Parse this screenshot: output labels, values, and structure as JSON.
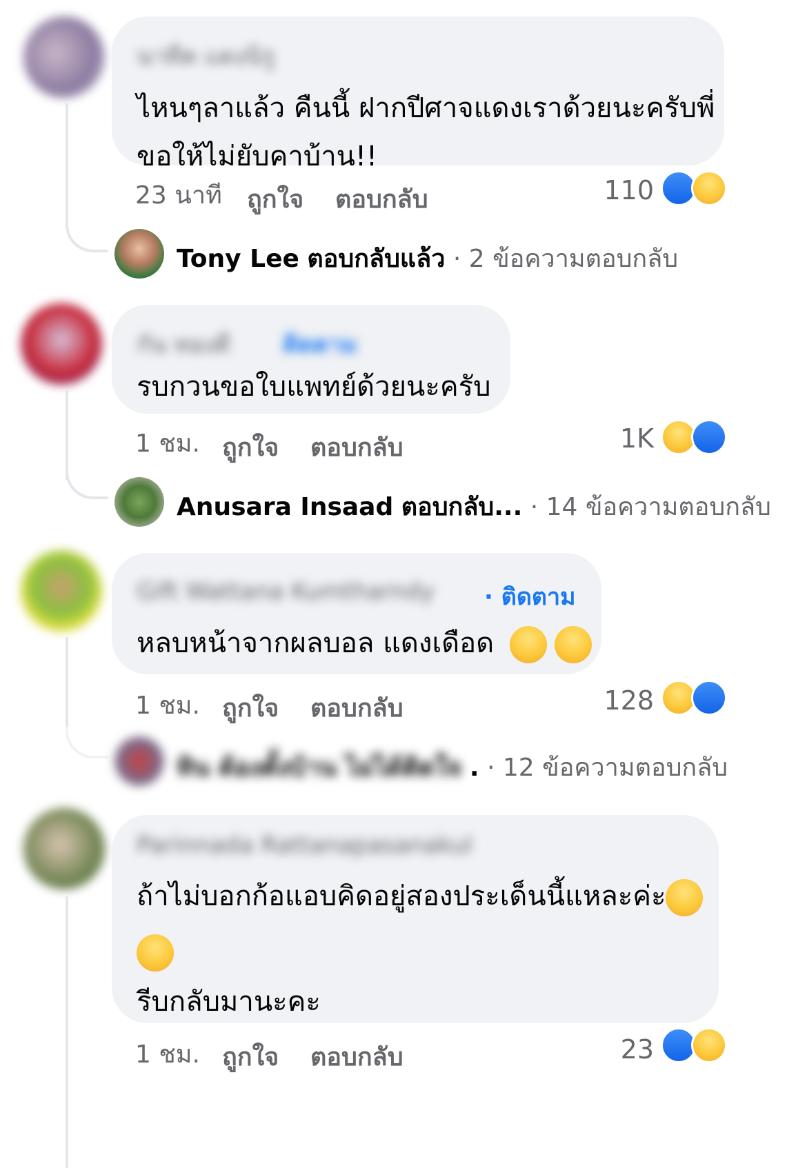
{
  "comments": [
    {
      "author": "นาทีค แดงนิรู",
      "text_lines": [
        "ไหนๆลาแล้ว คืนนี้ ฝากปีศาจแดงเราด้วยนะครับพี่",
        "ขอให้ไม่ยับคาบ้าน!!"
      ],
      "time": "23 นาที",
      "like_label": "ถูกใจ",
      "reply_label": "ตอบกลับ",
      "reaction_count": "110",
      "reactions": [
        "like-icon",
        "haha-icon"
      ],
      "reply_summary": {
        "name": "Tony Lee",
        "action": "ตอบกลับแล้ว",
        "count": "· 2 ข้อความตอบกลับ"
      }
    },
    {
      "author": "กัน ทองดี",
      "follow": "ติดตาม",
      "text_lines": [
        "รบกวนขอใบแพทย์ด้วยนะครับ"
      ],
      "time": "1 ชม.",
      "like_label": "ถูกใจ",
      "reply_label": "ตอบกลับ",
      "reaction_count": "1K",
      "reactions": [
        "haha-icon",
        "like-icon"
      ],
      "reply_summary": {
        "name": "Anusara Insaad",
        "action": "ตอบกลับ...",
        "count": "· 14 ข้อความตอบกลับ"
      }
    },
    {
      "author": "Gift Wattana Kumtharndy",
      "follow": "· ติดตาม",
      "text_lines": [
        "หลบหน้าจากผลบอล แดงเดือด"
      ],
      "emojis": [
        "tears-of-joy-emoji",
        "rolling-laughing-emoji"
      ],
      "time": "1 ชม.",
      "like_label": "ถูกใจ",
      "reply_label": "ตอบกลับ",
      "reaction_count": "128",
      "reactions": [
        "haha-icon",
        "like-icon"
      ],
      "reply_summary": {
        "name": "ทิน ต้องตั้งบ้าน ไม่ได้ติดใจ",
        "action": ".",
        "count": "· 12 ข้อความตอบกลับ"
      }
    },
    {
      "author": "Parinnada Rattanapasanakul",
      "text_lines": [
        "ถ้าไม่บอกก้อแอบคิดอยู่สองประเด็นนี้แหละค่ะ",
        "",
        "รีบกลับมานะคะ"
      ],
      "emojis": [
        "grinning-squinting-emoji",
        "grinning-squinting-emoji"
      ],
      "time": "1 ชม.",
      "like_label": "ถูกใจ",
      "reply_label": "ตอบกลับ",
      "reaction_count": "23",
      "reactions": [
        "like-icon",
        "haha-icon"
      ]
    }
  ]
}
